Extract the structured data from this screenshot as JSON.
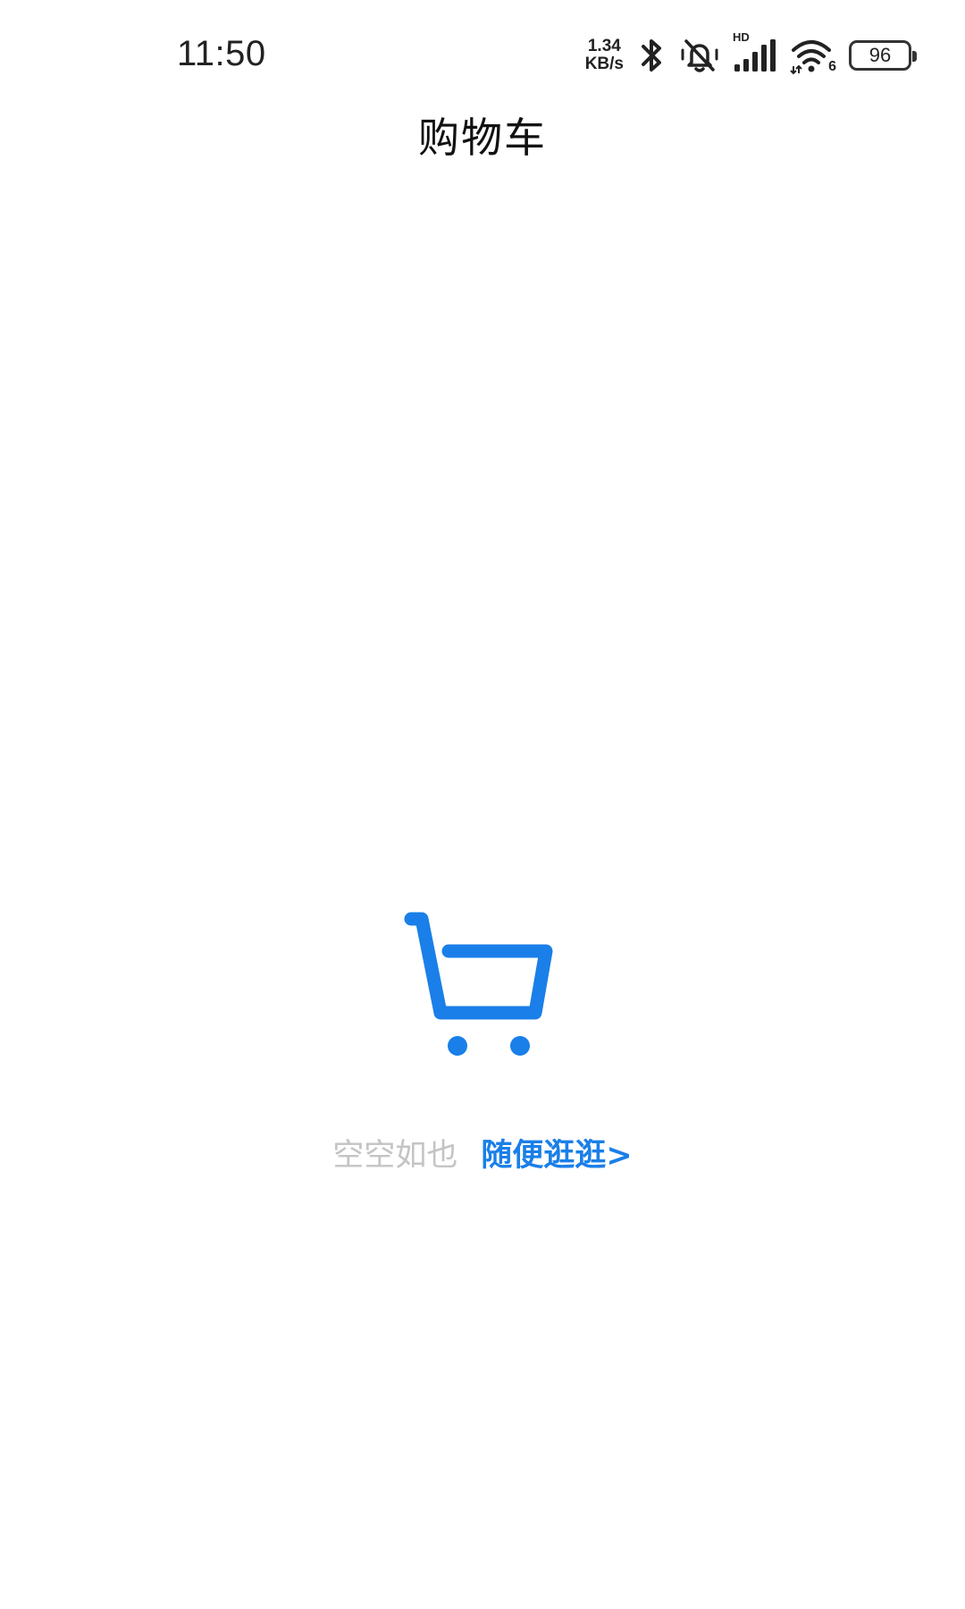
{
  "status_bar": {
    "time": "11:50",
    "net_speed_value": "1.34",
    "net_speed_unit": "KB/s",
    "signal_label": "HD",
    "wifi_label": "6",
    "battery": "96",
    "icons": [
      "bluetooth-icon",
      "silent-bell-icon",
      "signal-icon",
      "wifi-icon",
      "battery-icon"
    ]
  },
  "header": {
    "title": "购物车"
  },
  "empty_state": {
    "icon": "shopping-cart-icon",
    "message": "空空如也",
    "link_label": "随便逛逛>"
  },
  "colors": {
    "accent": "#1a7fe8",
    "muted_text": "#c4c4c4",
    "background": "#ffffff"
  }
}
